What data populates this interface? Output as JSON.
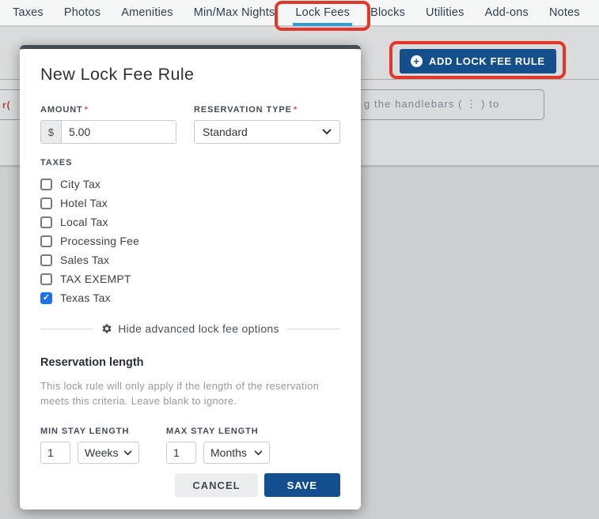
{
  "tabs": {
    "items": [
      {
        "label": "Taxes",
        "active": false
      },
      {
        "label": "Photos",
        "active": false
      },
      {
        "label": "Amenities",
        "active": false
      },
      {
        "label": "Min/Max Nights",
        "active": false
      },
      {
        "label": "Lock Fees",
        "active": true
      },
      {
        "label": "Blocks",
        "active": false
      },
      {
        "label": "Utilities",
        "active": false
      },
      {
        "label": "Add-ons",
        "active": false
      },
      {
        "label": "Notes",
        "active": false
      }
    ]
  },
  "toolbar": {
    "add_button_label": "ADD LOCK FEE RULE",
    "plus_icon": "+"
  },
  "background": {
    "handlebars_text": "g the handlebars ( ⋮ ) to",
    "left_fragment": "r("
  },
  "modal": {
    "title": "New Lock Fee Rule",
    "amount": {
      "label": "AMOUNT",
      "required": "*",
      "prefix": "$",
      "value": "5.00"
    },
    "reservation_type": {
      "label": "RESERVATION TYPE",
      "required": "*",
      "value": "Standard"
    },
    "taxes": {
      "label": "TAXES",
      "options": [
        {
          "label": "City Tax",
          "checked": false
        },
        {
          "label": "Hotel Tax",
          "checked": false
        },
        {
          "label": "Local Tax",
          "checked": false
        },
        {
          "label": "Processing Fee",
          "checked": false
        },
        {
          "label": "Sales Tax",
          "checked": false
        },
        {
          "label": "TAX EXEMPT",
          "checked": false
        },
        {
          "label": "Texas Tax",
          "checked": true
        }
      ]
    },
    "advanced_toggle": {
      "label": "Hide advanced lock fee options"
    },
    "reservation_length": {
      "heading": "Reservation length",
      "description": "This lock rule will only apply if the length of the reservation meets this criteria. Leave blank to ignore.",
      "min": {
        "label": "MIN STAY LENGTH",
        "value": "1",
        "unit": "Weeks"
      },
      "max": {
        "label": "MAX STAY LENGTH",
        "value": "1",
        "unit": "Months"
      }
    },
    "footer": {
      "cancel": "CANCEL",
      "save": "SAVE"
    }
  },
  "colors": {
    "accent_navy": "#144e8b",
    "tab_underline_blue": "#2f9cd9",
    "annotation_red": "#e2372b",
    "checkbox_blue": "#1a73e8",
    "required_red": "#dd5145"
  }
}
